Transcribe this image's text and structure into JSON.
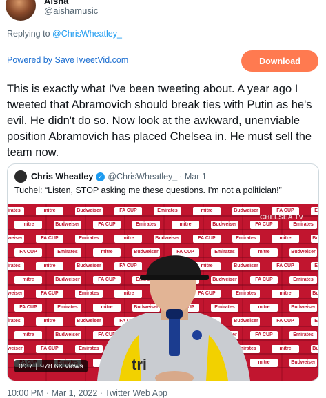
{
  "user": {
    "name": "Aisha",
    "handle": "@aishamusic"
  },
  "reply": {
    "prefix": "Replying to ",
    "mention": "@ChrisWheatley_"
  },
  "powered_by": "Powered by SaveTweetVid.com",
  "download_label": "Download",
  "tweet_text": "This is exactly what I've been tweeting about. A year ago I tweeted that Abramovich should break ties with Putin as he's evil. He didn't do so. Now look at the awkward, unenviable position Abramovich has placed Chelsea in. He must sell the team now.",
  "quoted": {
    "name": "Chris Wheatley",
    "handle": "@ChrisWheatley_",
    "date": "· Mar 1",
    "text": "Tuchel: “Listen, STOP asking me these questions. I'm not a politician!”",
    "video": {
      "watermark": "CHELSEA TV",
      "duration": "0:37",
      "views": "978.6K views",
      "sponsor_words": [
        "Emirates",
        "mitre",
        "Budweiser",
        "FA CUP"
      ]
    }
  },
  "footer": "10:00 PM · Mar 1, 2022 · Twitter Web App",
  "colors": {
    "accent": "#1d9bf0",
    "download": "#ff7a50",
    "board_red": "#c1152f"
  }
}
